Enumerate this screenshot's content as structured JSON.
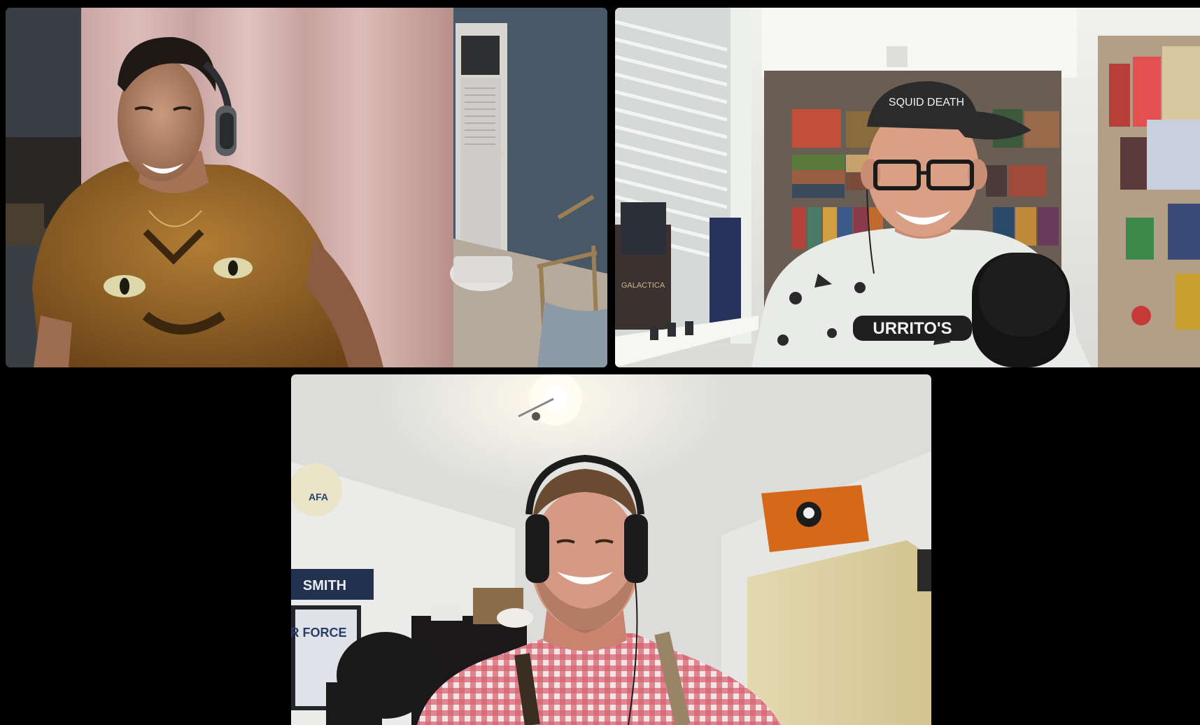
{
  "app": {
    "layout": "video-call-gallery"
  },
  "participants": [
    {
      "tile": "top-left",
      "headphones": true,
      "shirt_color": "#a9732e",
      "background": "bedroom with pink curtain and open door"
    },
    {
      "tile": "top-right",
      "headphones": false,
      "shirt_color": "#e9ebe8",
      "background": "board game shelves"
    },
    {
      "tile": "bottom-center",
      "headphones": true,
      "shirt_color": "#c84a52",
      "background": "room with ceiling light and orange flag"
    }
  ],
  "visible_text": {
    "cap_text": "SQUID DEATH",
    "shirt_text": "URRITO'S",
    "sign_text": "SMITH",
    "jersey_text": "AIR FORCE",
    "poster_text": "AFA",
    "box_text": "GALACTICA"
  },
  "colors": {
    "background": "#000000",
    "wall_blue": "#485866",
    "curtain": "#d9b7b4",
    "shelf": "#6a5d53",
    "ceiling_light": "#fffbe9",
    "flag": "#d6681a"
  }
}
